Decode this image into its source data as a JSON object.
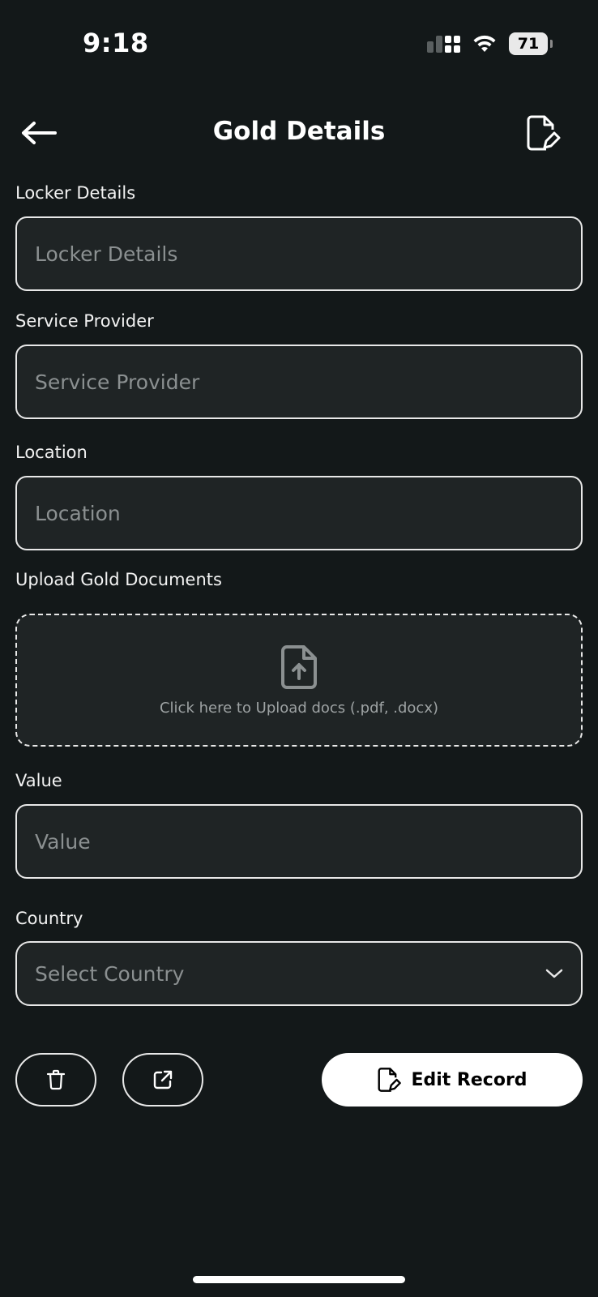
{
  "status_bar": {
    "time": "9:18",
    "battery": "71",
    "icons": [
      "signal-icon",
      "wifi-icon",
      "battery-icon"
    ]
  },
  "header": {
    "title": "Gold Details",
    "back_icon": "arrow-left-icon",
    "edit_icon": "document-edit-icon"
  },
  "form": {
    "locker": {
      "label": "Locker Details",
      "placeholder": "Locker Details",
      "value": ""
    },
    "provider": {
      "label": "Service Provider",
      "placeholder": "Service Provider",
      "value": ""
    },
    "location": {
      "label": "Location",
      "placeholder": "Location",
      "value": ""
    },
    "upload": {
      "label": "Upload Gold Documents",
      "hint": "Click here to Upload docs (.pdf, .docx)",
      "icon": "file-upload-icon"
    },
    "value": {
      "label": "Value",
      "placeholder": "Value",
      "value": ""
    },
    "country": {
      "label": "Country",
      "selected": "Select Country",
      "icon": "chevron-down-icon"
    }
  },
  "actions": {
    "delete_icon": "trash-icon",
    "share_icon": "external-link-icon",
    "edit_label": "Edit Record"
  },
  "colors": {
    "background": "#131819",
    "field_background": "#1f2425",
    "border": "#e8e8e8",
    "placeholder": "#8b9091",
    "primary_button": "#ffffff"
  }
}
